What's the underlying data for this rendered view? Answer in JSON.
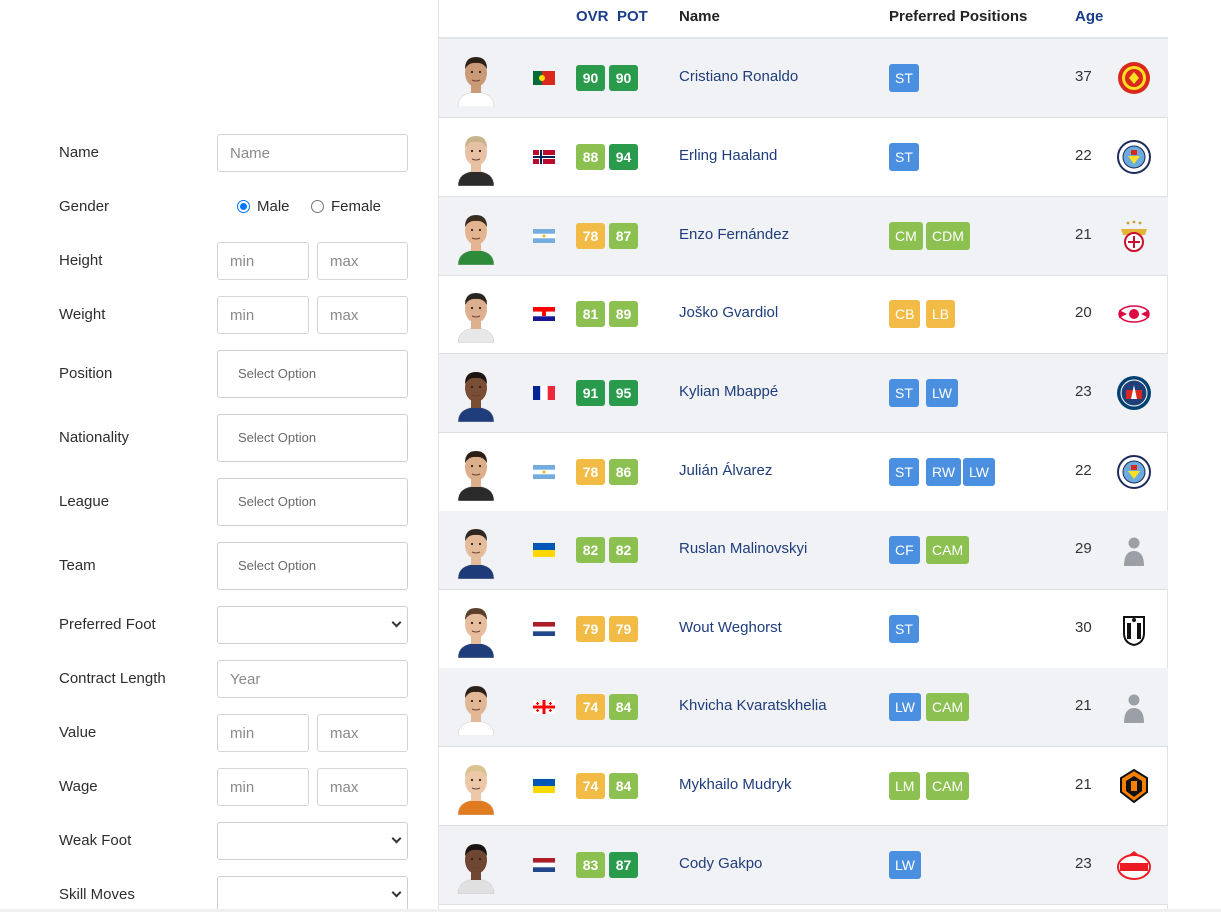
{
  "filters": {
    "name": {
      "label": "Name",
      "placeholder": "Name"
    },
    "gender": {
      "label": "Gender",
      "options": [
        "Male",
        "Female"
      ],
      "selected": "Male"
    },
    "height": {
      "label": "Height",
      "min_placeholder": "min",
      "max_placeholder": "max"
    },
    "weight": {
      "label": "Weight",
      "min_placeholder": "min",
      "max_placeholder": "max"
    },
    "position": {
      "label": "Position",
      "placeholder": "Select Option"
    },
    "nationality": {
      "label": "Nationality",
      "placeholder": "Select Option"
    },
    "league": {
      "label": "League",
      "placeholder": "Select Option"
    },
    "team": {
      "label": "Team",
      "placeholder": "Select Option"
    },
    "preferred_foot": {
      "label": "Preferred Foot",
      "value": ""
    },
    "contract_length": {
      "label": "Contract Length",
      "placeholder": "Year"
    },
    "value": {
      "label": "Value",
      "min_placeholder": "min",
      "max_placeholder": "max"
    },
    "wage": {
      "label": "Wage",
      "min_placeholder": "min",
      "max_placeholder": "max"
    },
    "weak_foot": {
      "label": "Weak Foot",
      "value": ""
    },
    "skill_moves": {
      "label": "Skill Moves",
      "value": ""
    }
  },
  "table": {
    "headers": {
      "ovr": "OVR",
      "pot": "POT",
      "name": "Name",
      "positions": "Preferred Positions",
      "age": "Age"
    },
    "rating_colors": {
      "high": "#2a9a4c",
      "good": "#8cc152",
      "mid": "#f2bb45"
    },
    "position_colors": {
      "attack": "#4a8fe0",
      "midfield": "#8cc152",
      "defense": "#f2bb45"
    },
    "players": [
      {
        "name": "Cristiano Ronaldo",
        "flag": "portugal-flag",
        "ovr": "90",
        "pot": "90",
        "ovr_tier": "high",
        "pot_tier": "high",
        "positions": [
          {
            "label": "ST",
            "group": "attack"
          }
        ],
        "age": "37",
        "club": "manchester-united-crest",
        "skin": "#c99a78",
        "hair": "#2b2118",
        "shirt": "#ffffff"
      },
      {
        "name": "Erling Haaland",
        "flag": "norway-flag",
        "ovr": "88",
        "pot": "94",
        "ovr_tier": "good",
        "pot_tier": "high",
        "positions": [
          {
            "label": "ST",
            "group": "attack"
          }
        ],
        "age": "22",
        "club": "manchester-city-crest",
        "skin": "#e8c0a4",
        "hair": "#c9b38a",
        "shirt": "#2b2b2b"
      },
      {
        "name": "Enzo Fernández",
        "flag": "argentina-flag",
        "ovr": "78",
        "pot": "87",
        "ovr_tier": "mid",
        "pot_tier": "good",
        "positions": [
          {
            "label": "CM",
            "group": "midfield"
          },
          {
            "label": "CDM",
            "group": "midfield"
          }
        ],
        "age": "21",
        "club": "benfica-crest",
        "skin": "#e3b48f",
        "hair": "#3a2c1f",
        "shirt": "#2e8b3a"
      },
      {
        "name": "Joško Gvardiol",
        "flag": "croatia-flag",
        "ovr": "81",
        "pot": "89",
        "ovr_tier": "good",
        "pot_tier": "good",
        "positions": [
          {
            "label": "CB",
            "group": "defense"
          },
          {
            "label": "LB",
            "group": "defense"
          }
        ],
        "age": "20",
        "club": "rb-leipzig-crest",
        "skin": "#dcb08e",
        "hair": "#2a2520",
        "shirt": "#e8e8e8"
      },
      {
        "name": "Kylian Mbappé",
        "flag": "france-flag",
        "ovr": "91",
        "pot": "95",
        "ovr_tier": "high",
        "pot_tier": "high",
        "positions": [
          {
            "label": "ST",
            "group": "attack"
          },
          {
            "label": "LW",
            "group": "attack"
          }
        ],
        "age": "23",
        "club": "paris-saint-germain-crest",
        "skin": "#7a4e34",
        "hair": "#1d1512",
        "shirt": "#1f3d7a"
      },
      {
        "name": "Julián Álvarez",
        "flag": "argentina-flag",
        "ovr": "78",
        "pot": "86",
        "ovr_tier": "mid",
        "pot_tier": "good",
        "positions": [
          {
            "label": "ST",
            "group": "attack"
          },
          {
            "label": "RW",
            "group": "attack"
          },
          {
            "label": "LW",
            "group": "attack"
          }
        ],
        "age": "22",
        "club": "manchester-city-crest",
        "skin": "#dcae8a",
        "hair": "#2a1e16",
        "shirt": "#2b2b2b"
      },
      {
        "name": "Ruslan Malinovskyi",
        "flag": "ukraine-flag",
        "ovr": "82",
        "pot": "82",
        "ovr_tier": "good",
        "pot_tier": "good",
        "positions": [
          {
            "label": "CF",
            "group": "attack"
          },
          {
            "label": "CAM",
            "group": "midfield"
          }
        ],
        "age": "29",
        "club": "unknown-club-silhouette",
        "skin": "#e4bc9c",
        "hair": "#2e2620",
        "shirt": "#1c3b78"
      },
      {
        "name": "Wout Weghorst",
        "flag": "netherlands-flag",
        "ovr": "79",
        "pot": "79",
        "ovr_tier": "mid",
        "pot_tier": "mid",
        "positions": [
          {
            "label": "ST",
            "group": "attack"
          }
        ],
        "age": "30",
        "club": "besiktas-crest",
        "skin": "#e6bd9d",
        "hair": "#5b3f2a",
        "shirt": "#1f3d7a"
      },
      {
        "name": "Khvicha Kvaratskhelia",
        "flag": "georgia-flag",
        "ovr": "74",
        "pot": "84",
        "ovr_tier": "mid",
        "pot_tier": "good",
        "positions": [
          {
            "label": "LW",
            "group": "attack"
          },
          {
            "label": "CAM",
            "group": "midfield"
          }
        ],
        "age": "21",
        "club": "unknown-club-silhouette",
        "skin": "#e2b795",
        "hair": "#2c2119",
        "shirt": "#ffffff"
      },
      {
        "name": "Mykhailo Mudryk",
        "flag": "ukraine-flag",
        "ovr": "74",
        "pot": "84",
        "ovr_tier": "mid",
        "pot_tier": "good",
        "positions": [
          {
            "label": "LM",
            "group": "midfield"
          },
          {
            "label": "CAM",
            "group": "midfield"
          }
        ],
        "age": "21",
        "club": "shakhtar-donetsk-crest",
        "skin": "#ecc7a8",
        "hair": "#d9c38e",
        "shirt": "#e07b1f"
      },
      {
        "name": "Cody Gakpo",
        "flag": "netherlands-flag",
        "ovr": "83",
        "pot": "87",
        "ovr_tier": "good",
        "pot_tier": "high",
        "positions": [
          {
            "label": "LW",
            "group": "attack"
          }
        ],
        "age": "23",
        "club": "psv-crest",
        "skin": "#6e4632",
        "hair": "#1a1411",
        "shirt": "#e0e0e0"
      }
    ]
  }
}
